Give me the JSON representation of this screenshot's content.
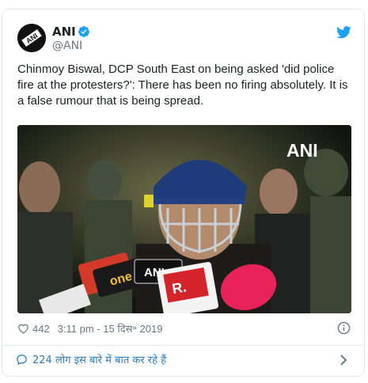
{
  "user": {
    "name": "ANI",
    "handle": "@ANI",
    "avatar_text": "ANI"
  },
  "tweet": {
    "text": "Chinmoy Biswal, DCP South East on being asked 'did police  fire at the protesters?': There has been no firing absolutely. It is a false rumour that is being spread."
  },
  "media": {
    "watermark": "ANI",
    "mic_labels": [
      "ANI",
      "R.",
      "one"
    ]
  },
  "meta": {
    "likes": "442",
    "timestamp": "3:11 pm - 15 दिस॰ 2019"
  },
  "footer": {
    "conversation": "224 लोग इस बारे में बात कर रहे हैं"
  },
  "colors": {
    "link": "#2b7bb9",
    "twitter_blue": "#1da1f2",
    "muted": "#697882",
    "border": "#e1e8ed"
  },
  "icons": [
    "verified-icon",
    "twitter-bird-icon",
    "heart-icon",
    "info-icon",
    "comment-icon",
    "chevron-right-icon"
  ]
}
